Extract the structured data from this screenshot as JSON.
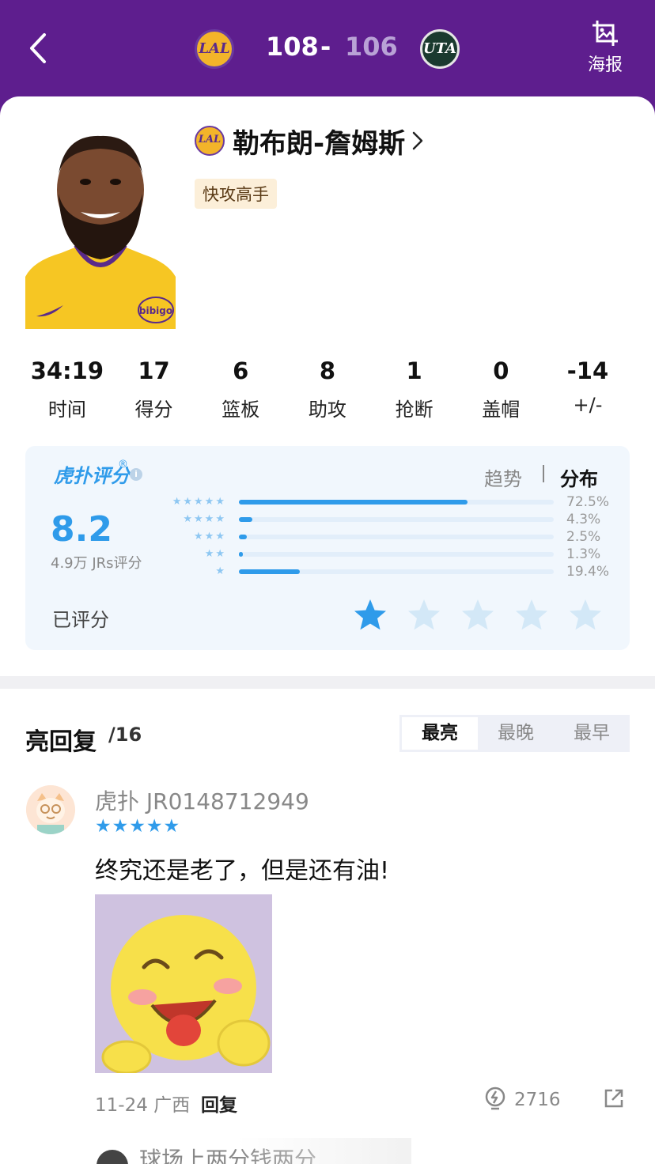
{
  "header": {
    "home_team_abbr": "LAL",
    "away_team_abbr": "UTA",
    "home_score": "108",
    "separator": "-",
    "away_score": "106",
    "poster_label": "海报"
  },
  "player": {
    "team_abbr": "LAL",
    "name": "勒布朗-詹姆斯",
    "tag": "快攻高手",
    "jersey_sponsor": "bibigo"
  },
  "stats": [
    {
      "value": "34:19",
      "label": "时间"
    },
    {
      "value": "17",
      "label": "得分"
    },
    {
      "value": "6",
      "label": "篮板"
    },
    {
      "value": "8",
      "label": "助攻"
    },
    {
      "value": "1",
      "label": "抢断"
    },
    {
      "value": "0",
      "label": "盖帽"
    },
    {
      "value": "-14",
      "label": "+/-"
    }
  ],
  "rating": {
    "brand": "虎扑评分",
    "brand_mark": "®",
    "tab_trend": "趋势",
    "tab_distribution": "分布",
    "score": "8.2",
    "count": "4.9万 JRs评分",
    "distribution": [
      {
        "stars": "★★★★★",
        "percent_label": "72.5%",
        "fraction": 0.725
      },
      {
        "stars": "★★★★",
        "percent_label": "4.3%",
        "fraction": 0.043
      },
      {
        "stars": "★★★",
        "percent_label": "2.5%",
        "fraction": 0.025
      },
      {
        "stars": "★★",
        "percent_label": "1.3%",
        "fraction": 0.013
      },
      {
        "stars": "★",
        "percent_label": "19.4%",
        "fraction": 0.194
      }
    ],
    "rated_label": "已评分",
    "user_rating": 1,
    "max_rating": 5
  },
  "comments_section": {
    "title": "亮回复",
    "count": "/16",
    "sort_tabs": [
      "最亮",
      "最晚",
      "最早"
    ],
    "active_sort": "最亮"
  },
  "comment": {
    "user": "虎扑 JR0148712949",
    "stars": "★★★★★",
    "text": "终究还是老了，但是还有油!",
    "meta": "11-24 广西",
    "reply_label": "回复",
    "light_count": "2716"
  },
  "next_comment": {
    "user": "球场上两分钱两分"
  },
  "colors": {
    "brand_purple": "#5e1e8e",
    "accent_blue": "#2f9bea",
    "tag_bg": "#fcefd9"
  },
  "icons": [
    "back-arrow-icon",
    "image-crop-icon",
    "chevron-right-icon",
    "info-icon",
    "star-icon",
    "lightbulb-icon",
    "share-icon"
  ]
}
